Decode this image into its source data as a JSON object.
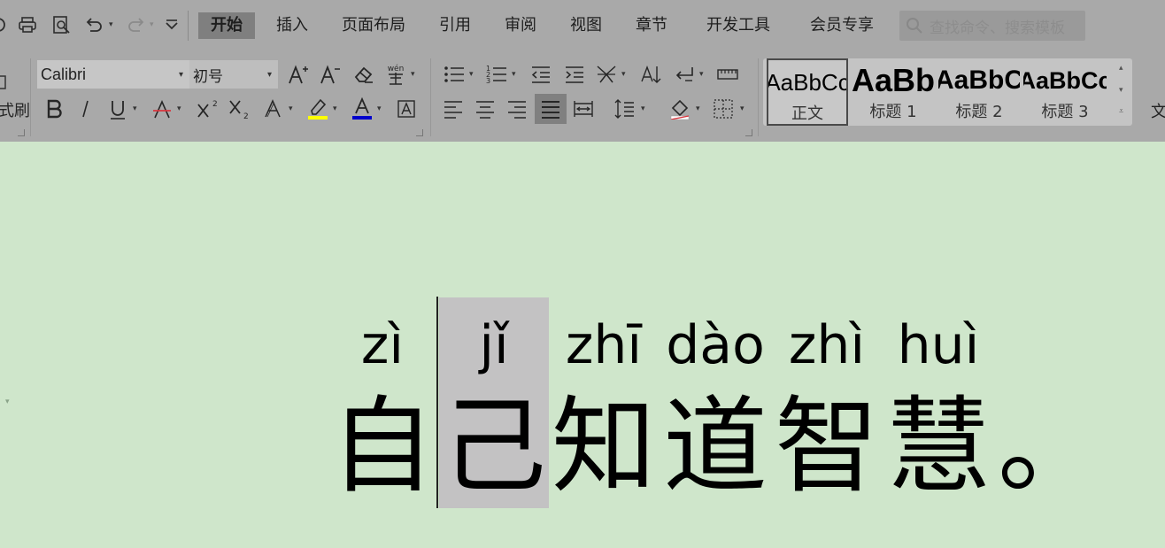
{
  "tabs": [
    {
      "label": "开始",
      "active": true
    },
    {
      "label": "插入"
    },
    {
      "label": "页面布局"
    },
    {
      "label": "引用"
    },
    {
      "label": "审阅"
    },
    {
      "label": "视图"
    },
    {
      "label": "章节"
    },
    {
      "label": "开发工具"
    },
    {
      "label": "会员专享"
    }
  ],
  "search": {
    "placeholder": "查找命令、搜索模板"
  },
  "clipboard": {
    "format_painter_label": "式刷"
  },
  "font": {
    "name": "Calibri",
    "size": "初号"
  },
  "styles": [
    {
      "preview": "AaBbCc",
      "label": "正文",
      "selected": true
    },
    {
      "preview": "AaBb",
      "label": "标题 1"
    },
    {
      "preview": "AaBbC",
      "label": "标题 2"
    },
    {
      "preview": "AaBbCc",
      "label": "标题 3"
    }
  ],
  "ribbon_overflow_label": "文",
  "document": {
    "ruby_text": [
      {
        "pinyin": "zì",
        "hanzi": "自"
      },
      {
        "pinyin": "jǐ",
        "hanzi": "己",
        "selected": true
      },
      {
        "pinyin": "zhī",
        "hanzi": "知"
      },
      {
        "pinyin": "dào",
        "hanzi": "道"
      },
      {
        "pinyin": "zhì",
        "hanzi": "智"
      },
      {
        "pinyin": "huì",
        "hanzi": "慧"
      },
      {
        "pinyin": "",
        "hanzi": "。"
      }
    ]
  },
  "colors": {
    "page_background": "#cfe6cb",
    "ribbon_background": "#a9a9a9",
    "selection": "#c3c2c3",
    "highlight_bar": "#ffff00",
    "font_color_bar": "#0000cc"
  },
  "icons": [
    "print-icon",
    "print-preview-icon",
    "undo-icon",
    "redo-icon",
    "customize-quick-access-icon",
    "search-icon",
    "grow-font-icon",
    "shrink-font-icon",
    "clear-format-icon",
    "phonetic-guide-icon",
    "bold-icon",
    "italic-icon",
    "underline-icon",
    "strikethrough-icon",
    "superscript-icon",
    "subscript-icon",
    "text-effect-icon",
    "highlight-icon",
    "font-color-icon",
    "char-border-icon",
    "bullets-icon",
    "numbering-icon",
    "decrease-indent-icon",
    "increase-indent-icon",
    "chinese-layout-icon",
    "sort-icon",
    "show-marks-icon",
    "tab-ruler-icon",
    "align-left-icon",
    "align-center-icon",
    "align-right-icon",
    "justify-icon",
    "distributed-icon",
    "line-spacing-icon",
    "shading-icon",
    "borders-icon"
  ]
}
